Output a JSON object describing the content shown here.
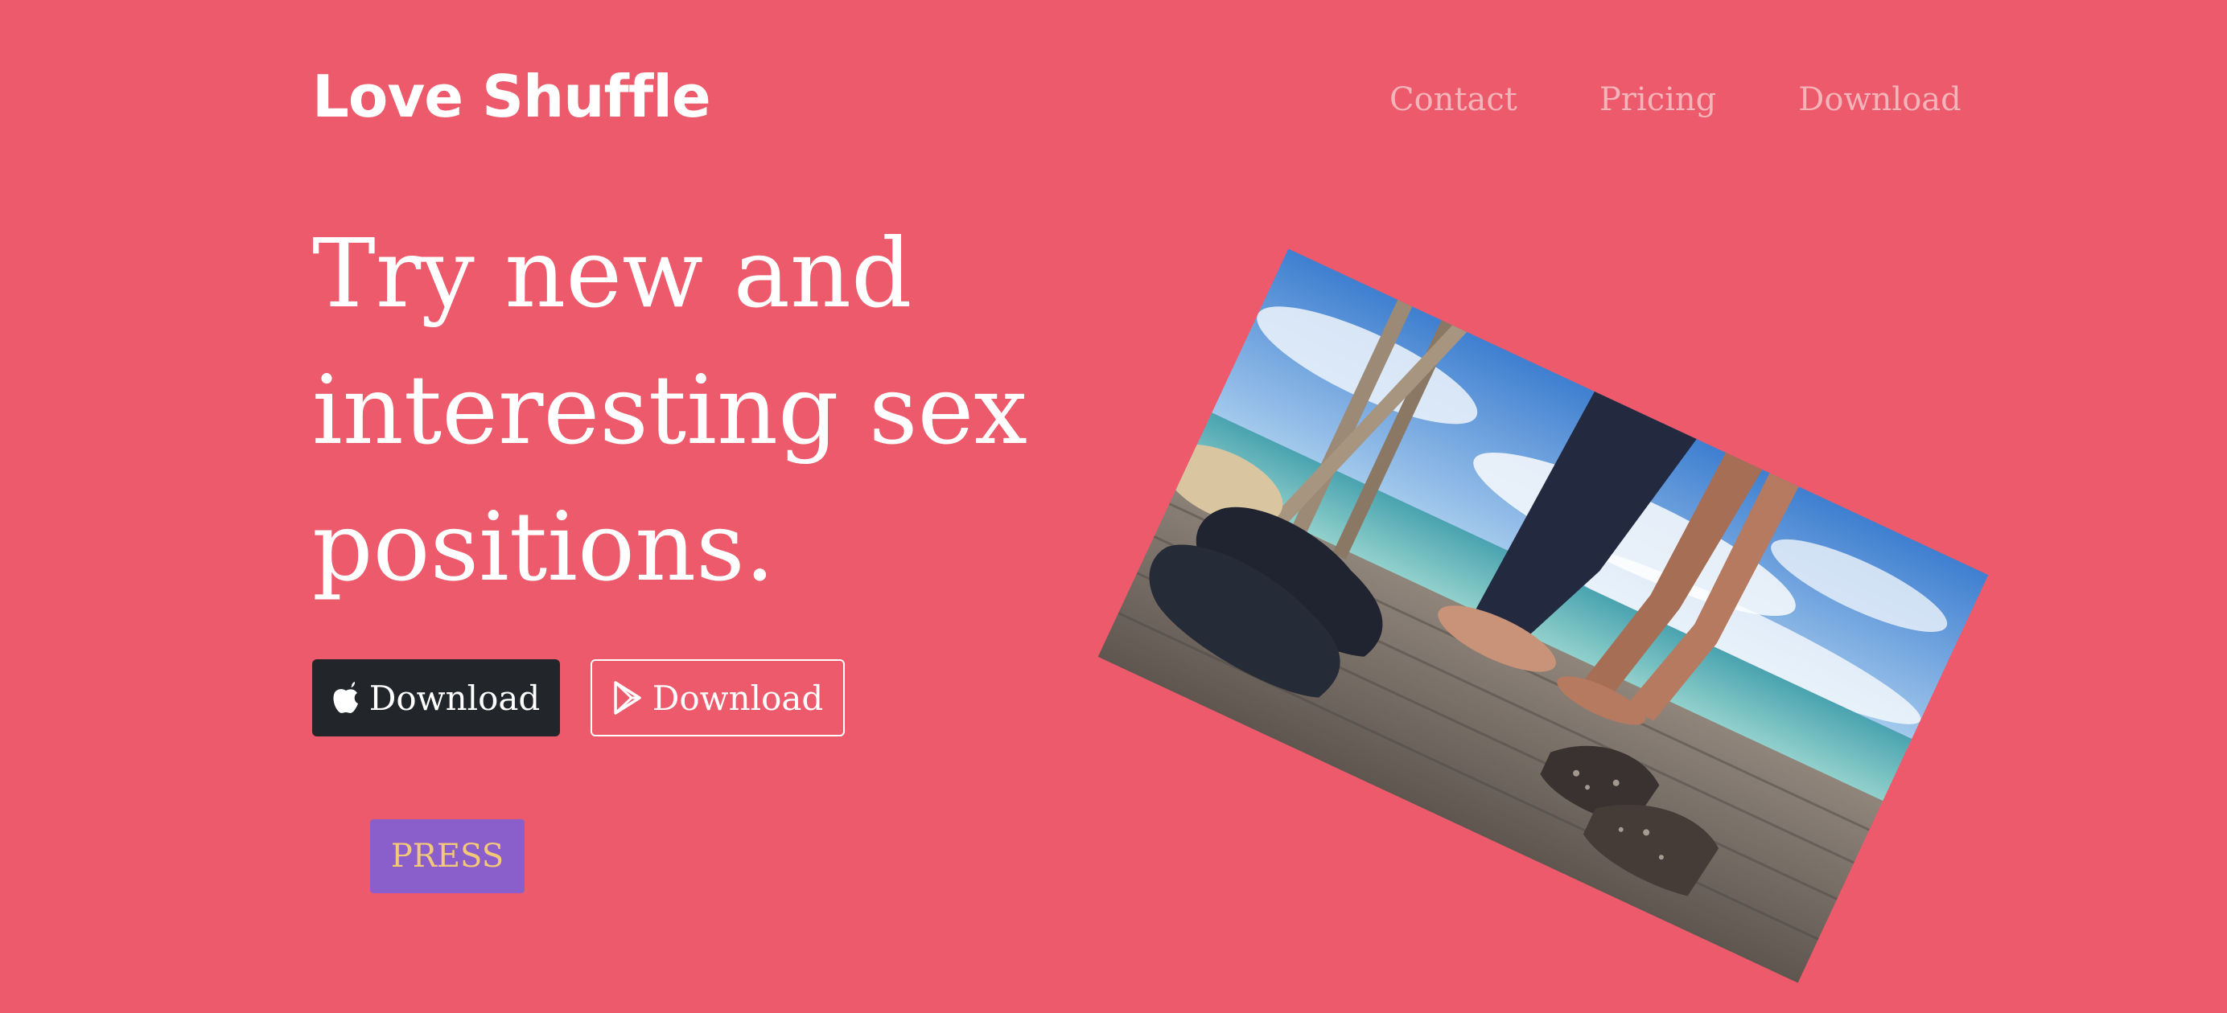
{
  "brand": {
    "name": "Love Shuffle"
  },
  "nav": {
    "items": [
      {
        "label": "Contact"
      },
      {
        "label": "Pricing"
      },
      {
        "label": "Download"
      }
    ]
  },
  "hero": {
    "headline": "Try new and interesting sex positions.",
    "ios_button": {
      "label": "Download",
      "icon": "apple-icon"
    },
    "play_button": {
      "label": "Download",
      "icon": "google-play-icon"
    },
    "press_button": {
      "label": "PRESS"
    },
    "image": {
      "description_icon": "couple-photo"
    }
  },
  "colors": {
    "background": "#ec5a6b",
    "nav_link": "#f5b3ba",
    "dark_button": "#22262a",
    "press_button": "#8b5fcb",
    "press_text": "#f3c87a"
  }
}
